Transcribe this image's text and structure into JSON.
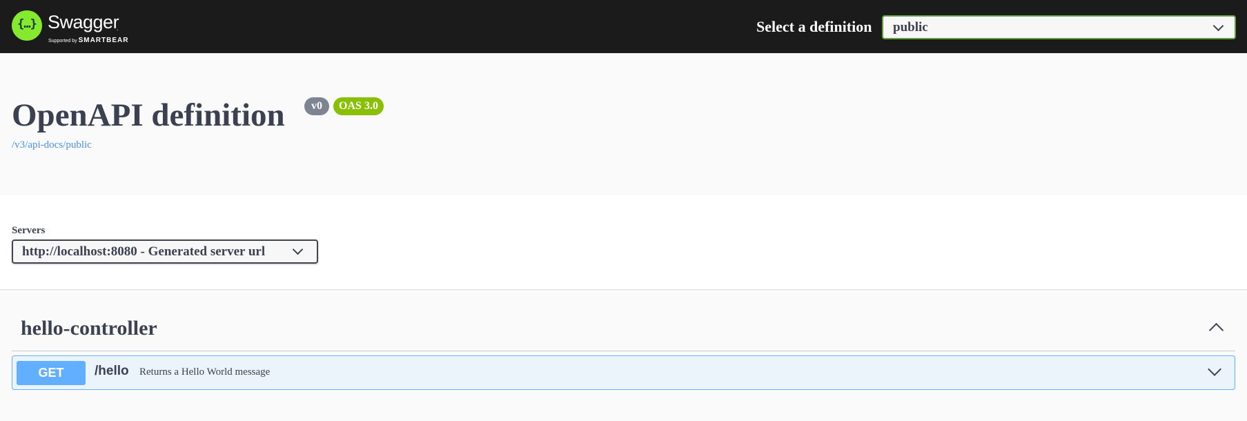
{
  "topbar": {
    "brand_name": "Swagger",
    "brand_tm": ".",
    "brand_supported": "Supported by",
    "brand_company": "SMARTBEAR",
    "logo_glyph": "{…}",
    "select_definition_label": "Select a definition",
    "definition_value": "public",
    "colors": {
      "background": "#1b1b1b",
      "logo": "#85ea2d",
      "select_border": "#62a03f"
    }
  },
  "info": {
    "title": "OpenAPI definition",
    "version_badge": "v0",
    "oas_badge": "OAS 3.0",
    "docs_link": "/v3/api-docs/public",
    "colors": {
      "version_badge": "#7d8492",
      "oas_badge": "#89bf04",
      "link": "#4990e2"
    }
  },
  "servers": {
    "label": "Servers",
    "selected": "http://localhost:8080 - Generated server url"
  },
  "operations": {
    "tag": "hello-controller",
    "items": [
      {
        "method": "GET",
        "path": "/hello",
        "summary": "Returns a Hello World message",
        "color": "#61affe"
      }
    ]
  }
}
